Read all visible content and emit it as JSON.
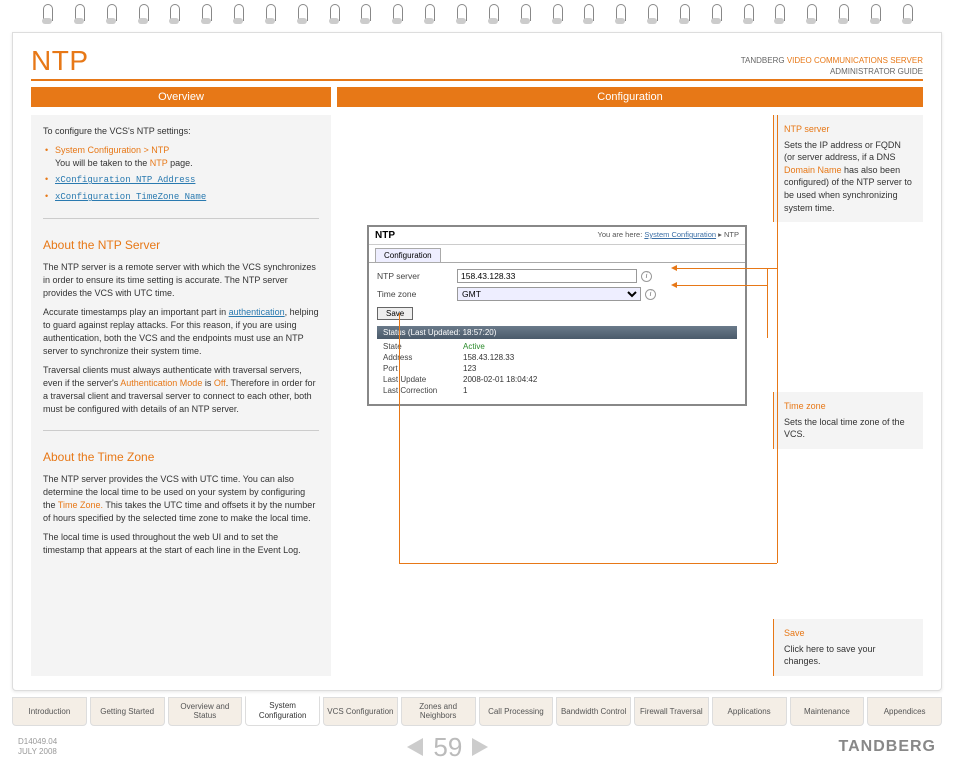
{
  "doc_header": {
    "line1_brand": "TANDBERG",
    "line1_product": "VIDEO COMMUNICATIONS SERVER",
    "line2": "ADMINISTRATOR GUIDE"
  },
  "page_title": "NTP",
  "section_headers": {
    "left": "Overview",
    "right": "Configuration"
  },
  "overview": {
    "intro": "To configure the VCS's NTP settings:",
    "bullets": [
      {
        "path": "System Configuration > NTP",
        "desc_pre": "You will be taken to the ",
        "desc_link": "NTP",
        "desc_post": " page."
      },
      {
        "cmd": "xConfiguration NTP Address"
      },
      {
        "cmd": "xConfiguration TimeZone Name"
      }
    ],
    "about_ntp_h": "About the NTP Server",
    "about_ntp_p1": "The NTP server is a remote server with which the VCS synchronizes in order to ensure its time setting is accurate.  The NTP server provides the VCS with UTC time.",
    "about_ntp_p2_pre": "Accurate timestamps play an important part in ",
    "about_ntp_p2_link": "authentication",
    "about_ntp_p2_post": ", helping to guard against replay attacks.  For this reason, if you are using authentication, both the VCS and the endpoints must use an NTP server to synchronize their system time.",
    "about_ntp_p3_pre": "Traversal clients must always authenticate with traversal servers, even if the server's ",
    "about_ntp_p3_link1": "Authentication Mode",
    "about_ntp_p3_mid": " is ",
    "about_ntp_p3_link2": "Off",
    "about_ntp_p3_post": ". Therefore in order for a traversal client and traversal server to connect to each other, both must be configured with details of an NTP server.",
    "about_tz_h": "About the Time Zone",
    "about_tz_p1_pre": "The NTP server provides the VCS with UTC time.  You can also determine the local time to be used on your system by configuring the ",
    "about_tz_p1_link": "Time Zone.",
    "about_tz_p1_post": "  This takes the UTC time and offsets it by the number of hours specified by the selected time zone to make the local time.",
    "about_tz_p2": "The local time is used throughout the web UI and to set the timestamp that appears at the start of each line in the Event Log."
  },
  "screenshot": {
    "title": "NTP",
    "crumb_pre": "You are here: ",
    "crumb_link": "System Configuration",
    "crumb_sep": " ▸ ",
    "crumb_cur": "NTP",
    "tab": "Configuration",
    "row_ntp_label": "NTP server",
    "row_ntp_value": "158.43.128.33",
    "row_tz_label": "Time zone",
    "row_tz_value": "GMT",
    "save": "Save",
    "status_header": "Status (Last Updated: 18:57:20)",
    "status_rows": [
      {
        "label": "State",
        "value": "Active",
        "green": true
      },
      {
        "label": "Address",
        "value": "158.43.128.33"
      },
      {
        "label": "Port",
        "value": "123"
      },
      {
        "label": "Last Update",
        "value": "2008-02-01 18:04:42"
      },
      {
        "label": "Last Correction",
        "value": "1"
      }
    ]
  },
  "annotations": {
    "ntp": {
      "title": "NTP server",
      "body_pre": "Sets the IP address or FQDN (or server address, if a DNS ",
      "body_link": "Domain Name",
      "body_post": " has also been configured) of the NTP server to be used when synchronizing system time."
    },
    "tz": {
      "title": "Time zone",
      "body": "Sets the local time zone of the VCS."
    },
    "save": {
      "title": "Save",
      "body": "Click here to save your changes."
    }
  },
  "bottom_tabs": [
    "Introduction",
    "Getting Started",
    "Overview and Status",
    "System Configuration",
    "VCS Configuration",
    "Zones and Neighbors",
    "Call Processing",
    "Bandwidth Control",
    "Firewall Traversal",
    "Applications",
    "Maintenance",
    "Appendices"
  ],
  "bottom_active_index": 3,
  "footer": {
    "code": "D14049.04",
    "date": "JULY 2008",
    "page": "59",
    "brand": "TANDBERG"
  }
}
